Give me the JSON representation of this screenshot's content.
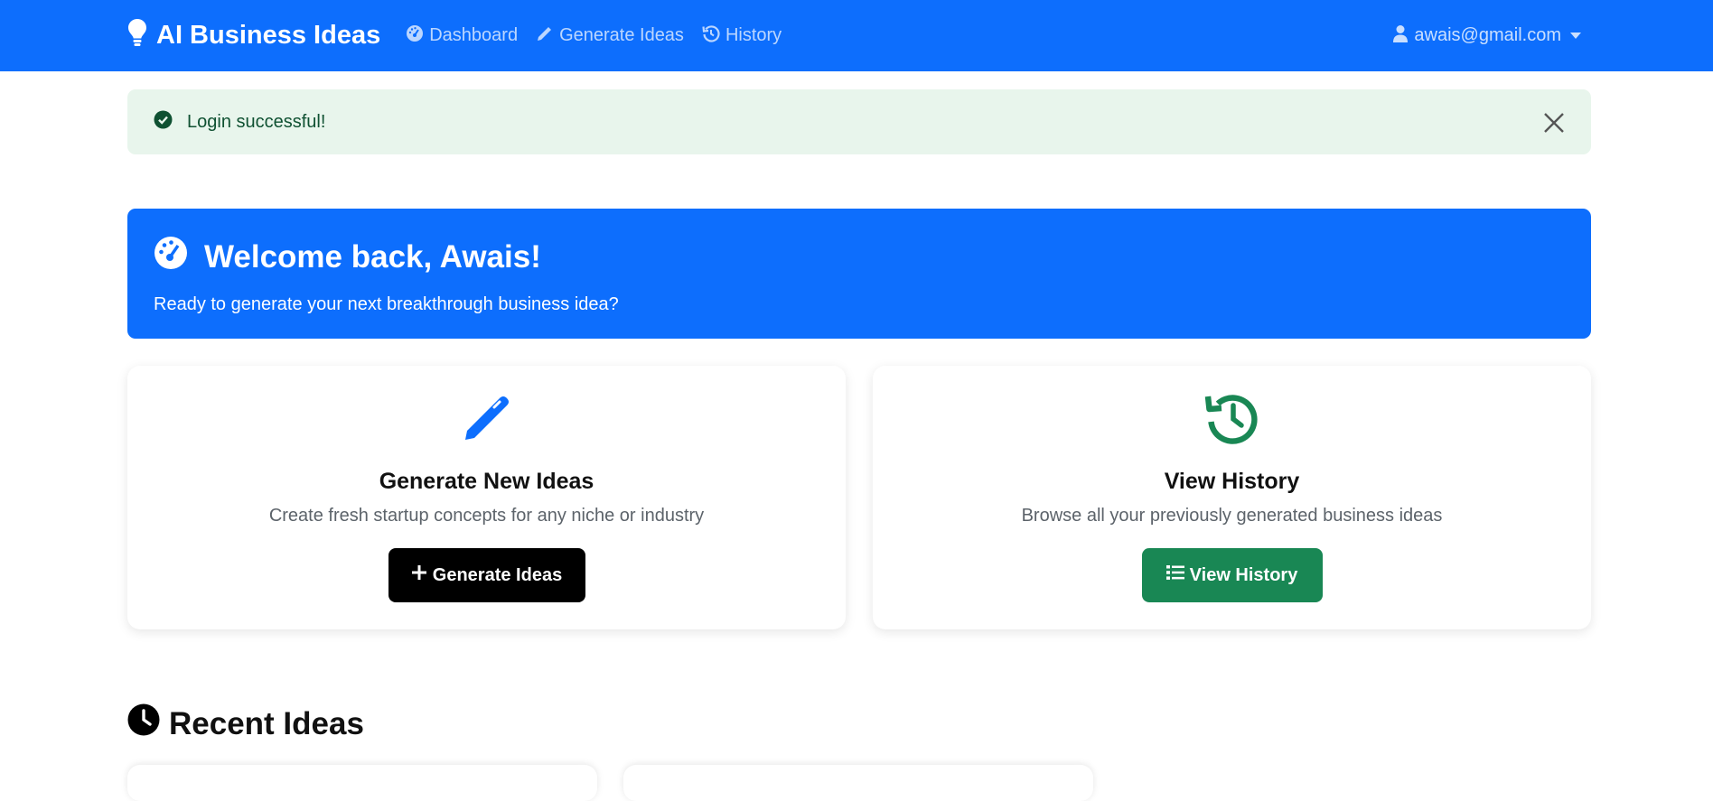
{
  "navbar": {
    "brand": "AI Business Ideas",
    "links": [
      {
        "label": "Dashboard",
        "icon": "gauge-icon"
      },
      {
        "label": "Generate Ideas",
        "icon": "pencil-icon"
      },
      {
        "label": "History",
        "icon": "history-icon"
      }
    ],
    "user_email": "awais@gmail.com",
    "colors": {
      "background": "#0d6efd"
    }
  },
  "alert": {
    "message": "Login successful!",
    "icon": "check-circle-icon",
    "colors": {
      "background": "#e8f5ec",
      "text": "#0f5132"
    }
  },
  "welcome": {
    "title": "Welcome back, Awais!",
    "subtitle": "Ready to generate your next breakthrough business idea?",
    "icon": "gauge-icon"
  },
  "cards": [
    {
      "title": "Generate New Ideas",
      "description": "Create fresh startup concepts for any niche or industry",
      "button_label": "Generate Ideas",
      "icon": "pencil-icon",
      "button_icon": "plus-icon",
      "accent": "#0d6efd",
      "button_color": "#000000"
    },
    {
      "title": "View History",
      "description": "Browse all your previously generated business ideas",
      "button_label": "View History",
      "icon": "history-icon",
      "button_icon": "list-icon",
      "accent": "#198754",
      "button_color": "#198754"
    }
  ],
  "recent": {
    "title": "Recent Ideas",
    "icon": "clock-icon"
  }
}
